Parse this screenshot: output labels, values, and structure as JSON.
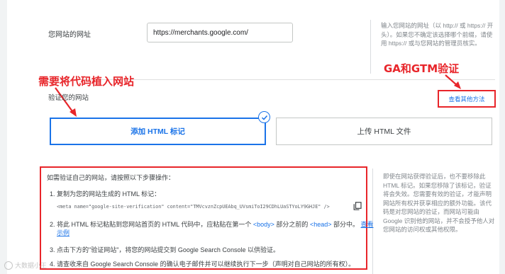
{
  "site": {
    "label": "您网站的网址",
    "url_value": "https://merchants.google.com/",
    "help": "输入您网站的网址（以 http:// 或 https:// 开头）。如果您不确定该选择哪个前缀，请使用 https:// 或与您网站的管理员核实。"
  },
  "annotations": {
    "embed_code": "需要将代码植入网站",
    "ga_gtm": "GA和GTM验证"
  },
  "verify": {
    "label": "验证您的网站",
    "other_methods": "查看其他方法",
    "method_html": "添加 HTML 标记",
    "method_upload": "上传 HTML 文件"
  },
  "instructions": {
    "intro": "如需验证自己的网站，请按照以下步骤操作：",
    "step1": "1. 复制为您的网站生成的 HTML 标记：",
    "meta_code": "<meta name=\"google-site-verification\" content=\"TMVcvznZcpUEAbq_UVsmiToI29CDhLUaSTYoLY9GHJE\" />",
    "step2_a": "2. 将此 HTML 标记粘贴到您网站首页的 HTML 代码中，应粘贴在第一个",
    "step2_body": "<body>",
    "step2_b": "部分之前的",
    "step2_head": "<head>",
    "step2_c": "部分中。",
    "step2_link1": "查看",
    "step2_link2": "示例",
    "step3": "3. 点击下方的\"验证网站\"，将您的网站提交到 Google Search Console 以供验证。",
    "step4": "4. 请查收来自 Google Search Console 的确认电子邮件并可以继续执行下一步（声明对自己网站的所有权）。"
  },
  "help_bottom": "即使在网站获得验证后，也不要移除此 HTML 标记。如果您移除了该标记，验证将会失效。您需要有效的验证，才能声明网站所有权并获享相应的额外功能。该代码是对您网站的验证，而网站可能由 Google 识别他的网站，并不会授予他人对您网站的访问权或其他权限。",
  "watermark": "大数据小王",
  "colors": {
    "accent": "#1a73e8",
    "annotation_red": "#e8252a"
  }
}
